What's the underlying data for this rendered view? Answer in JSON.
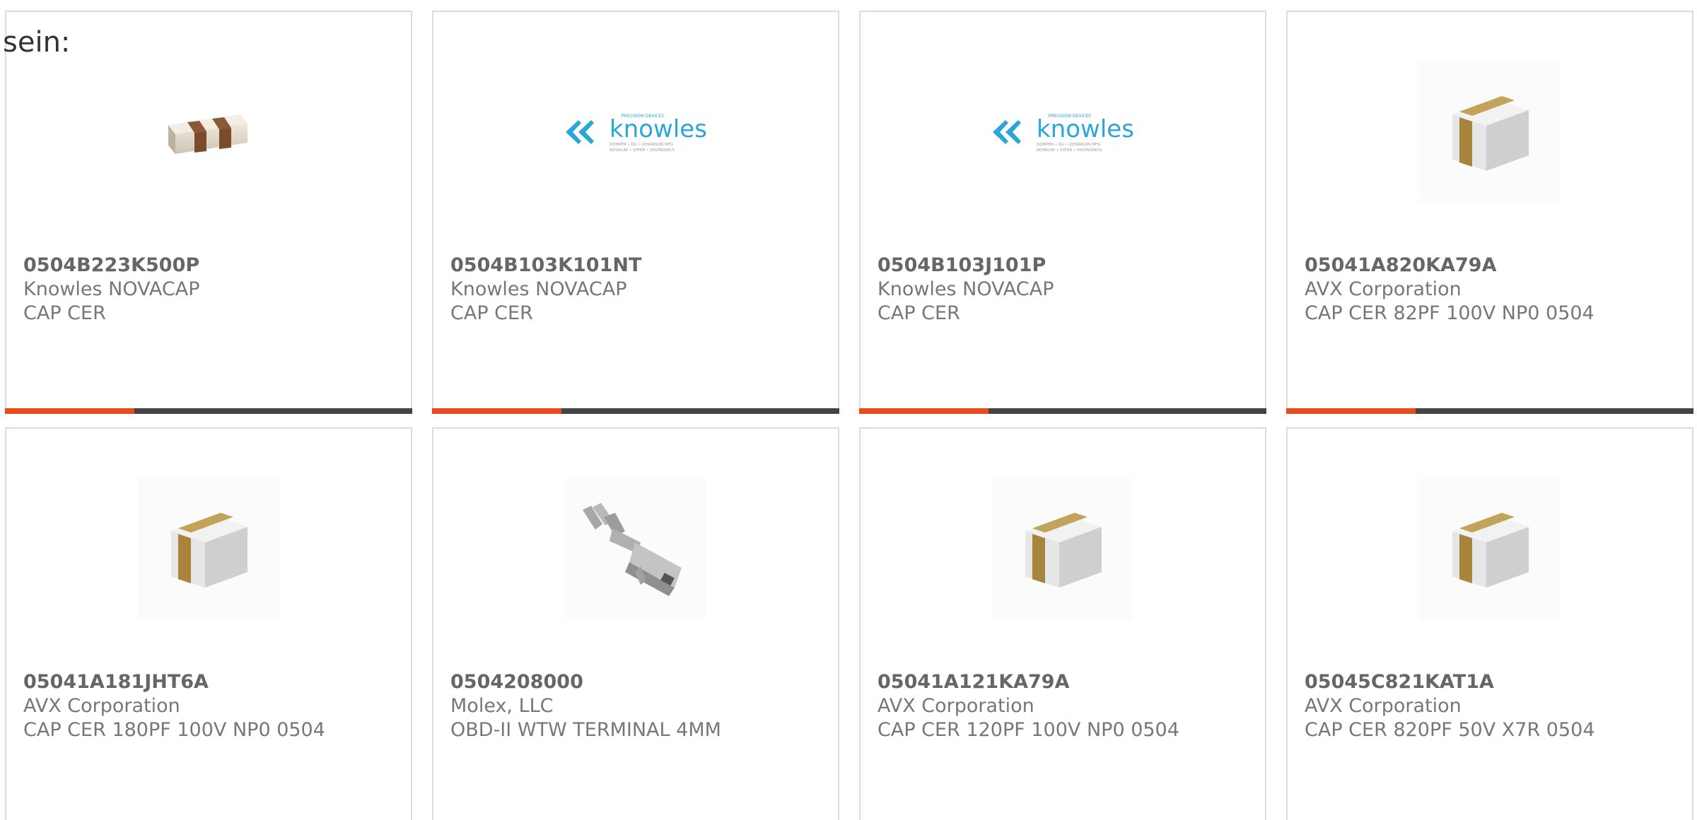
{
  "intro_text": "sein:",
  "colors": {
    "accent": "#ea4b1e",
    "bar": "#444444",
    "brand_knowles": "#2aa6d8",
    "card_border": "#dcdcdc"
  },
  "products": [
    {
      "part_number": "0504B223K500P",
      "manufacturer": "Knowles NOVACAP",
      "description": "CAP CER",
      "image": "chip-capacitor-striped"
    },
    {
      "part_number": "0504B103K101NT",
      "manufacturer": "Knowles NOVACAP",
      "description": "CAP CER",
      "image": "knowles-logo",
      "logo": {
        "wordmark": "knowles",
        "tag": "PRECISION DEVICES",
        "line1": "DOMPER • DLI • JOHANSON MFG",
        "line2": "NOVACAP • SYFER • VOLTRONICS"
      }
    },
    {
      "part_number": "0504B103J101P",
      "manufacturer": "Knowles NOVACAP",
      "description": "CAP CER",
      "image": "knowles-logo",
      "logo": {
        "wordmark": "knowles",
        "tag": "PRECISION DEVICES",
        "line1": "DOMPER • DLI • JOHANSON MFG",
        "line2": "NOVACAP • SYFER • VOLTRONICS"
      }
    },
    {
      "part_number": "05041A820KA79A",
      "manufacturer": "AVX Corporation",
      "description": "CAP CER 82PF 100V NP0 0504",
      "image": "mlcc-cube"
    },
    {
      "part_number": "05041A181JHT6A",
      "manufacturer": "AVX Corporation",
      "description": "CAP CER 180PF 100V NP0 0504",
      "image": "mlcc-cube"
    },
    {
      "part_number": "0504208000",
      "manufacturer": "Molex, LLC",
      "description": "OBD-II WTW TERMINAL 4MM",
      "image": "crimp-terminal"
    },
    {
      "part_number": "05041A121KA79A",
      "manufacturer": "AVX Corporation",
      "description": "CAP CER 120PF 100V NP0 0504",
      "image": "mlcc-cube"
    },
    {
      "part_number": "05045C821KAT1A",
      "manufacturer": "AVX Corporation",
      "description": "CAP CER 820PF 50V X7R 0504",
      "image": "mlcc-cube"
    }
  ]
}
